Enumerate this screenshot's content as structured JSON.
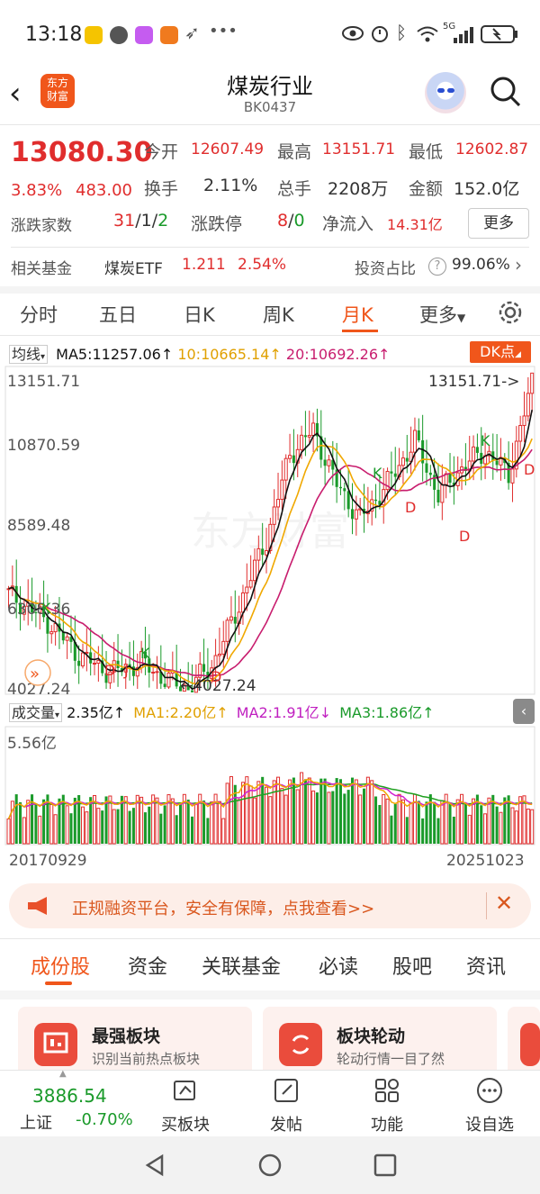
{
  "status_bar": {
    "time": "13:18",
    "signal": "5G"
  },
  "header": {
    "title": "煤炭行业",
    "code": "BK0437",
    "logo_text": "东方财富"
  },
  "quote": {
    "price": "13080.30",
    "change_pct": "3.83%",
    "change": "483.00",
    "open_label": "今开",
    "open": "12607.49",
    "high_label": "最高",
    "high": "13151.71",
    "low_label": "最低",
    "low": "12602.87",
    "turnover_label": "换手",
    "turnover": "2.11%",
    "volume_label": "总手",
    "volume": "2208万",
    "amount_label": "金额",
    "amount": "152.0亿",
    "breadth_label": "涨跌家数",
    "breadth_up": "31",
    "breadth_sep1": "/",
    "breadth_flat": "1",
    "breadth_sep2": "/",
    "breadth_down": "2",
    "limit_label": "涨跌停",
    "limit_up": "8",
    "limit_sep": "/",
    "limit_down": "0",
    "inflow_label": "净流入",
    "inflow": "14.31亿",
    "more_button": "更多"
  },
  "fund": {
    "label": "相关基金",
    "name": "煤炭ETF",
    "price": "1.211",
    "pct": "2.54%",
    "ratio_label": "投资占比",
    "ratio": "99.06%"
  },
  "ktabs": [
    {
      "label": "分时"
    },
    {
      "label": "五日"
    },
    {
      "label": "日K"
    },
    {
      "label": "周K"
    },
    {
      "label": "月K"
    },
    {
      "label": "更多"
    }
  ],
  "ma_row": {
    "selector": "均线",
    "ma5": "MA5:11257.06",
    "ma10": "10:10665.14",
    "ma20": "20:10692.26",
    "dk": "DK点"
  },
  "vol_row": {
    "selector": "成交量",
    "vol": "2.35亿",
    "ma1": "MA1:2.20亿",
    "ma2": "MA2:1.91亿",
    "ma3": "MA3:1.86亿"
  },
  "chart_data": {
    "type": "candlestick",
    "price_axis": [
      "13151.71",
      "10870.59",
      "8589.48",
      "6308.36",
      "4027.24"
    ],
    "ylim": [
      4027.24,
      13151.71
    ],
    "max_marker": "13151.71->",
    "min_marker": "←4027.24",
    "volume_axis_max": "5.56亿",
    "x_start": "20170929",
    "x_end": "20251023",
    "signal_markers": [
      "K",
      "D",
      "J",
      "D",
      "K",
      "D",
      "D",
      "K",
      "K",
      "D"
    ],
    "ma_colors": {
      "ma5": "#111111",
      "ma10": "#f0a800",
      "ma20": "#d0207a"
    },
    "vol_ma_colors": {
      "ma1": "#f0a800",
      "ma2": "#d020d0",
      "ma3": "#20a020"
    },
    "watermark": "东方财富"
  },
  "banner": {
    "text": "正规融资平台，安全有保障，点我查看>>"
  },
  "section_tabs": [
    {
      "label": "成份股"
    },
    {
      "label": "资金"
    },
    {
      "label": "关联基金"
    },
    {
      "label": "必读"
    },
    {
      "label": "股吧"
    },
    {
      "label": "资讯"
    }
  ],
  "cards": [
    {
      "title": "最强板块",
      "sub": "识别当前热点板块"
    },
    {
      "title": "板块轮动",
      "sub": "轮动行情一目了然"
    }
  ],
  "bottom_bar": {
    "index_value": "3886.54",
    "index_name": "上证",
    "index_pct": "-0.70%",
    "items": [
      {
        "label": "买板块"
      },
      {
        "label": "发帖"
      },
      {
        "label": "功能"
      },
      {
        "label": "设自选"
      }
    ]
  },
  "colors": {
    "up": "#e02d2d",
    "down": "#1a9a2a",
    "accent": "#f0561b"
  }
}
